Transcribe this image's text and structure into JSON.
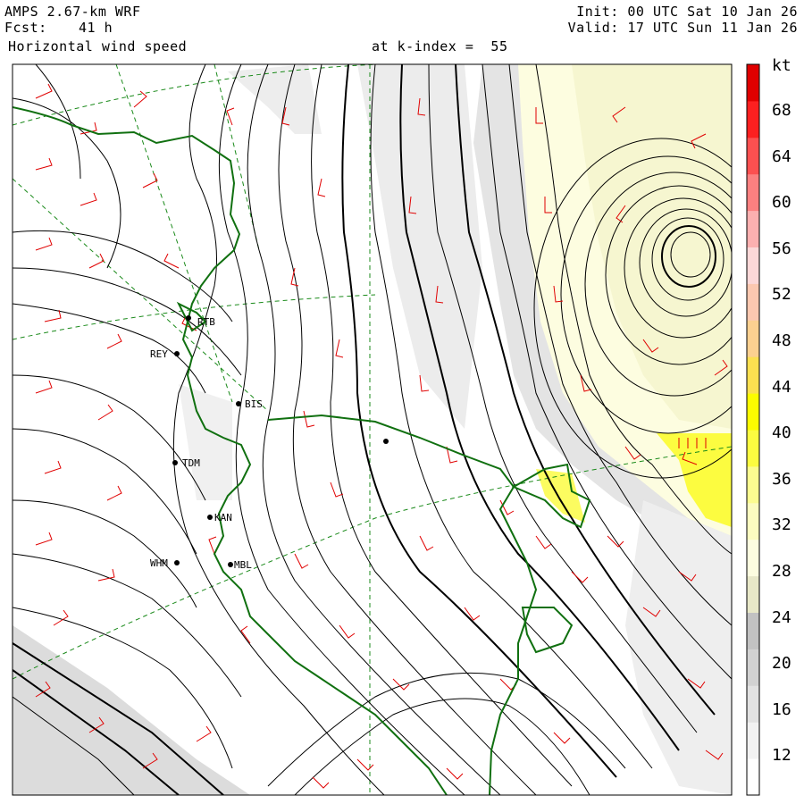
{
  "header": {
    "model": "AMPS 2.67-km WRF",
    "forecast_label": "Fcst:",
    "forecast_value": "41 h",
    "field": "Horizontal wind speed",
    "level": "at k-index =  55",
    "init": "Init: 00 UTC Sat 10 Jan 26",
    "valid": "Valid: 17 UTC Sun 11 Jan 26"
  },
  "colorbar": {
    "unit": "kt",
    "labels": [
      "68",
      "64",
      "60",
      "56",
      "52",
      "48",
      "44",
      "40",
      "36",
      "32",
      "28",
      "24",
      "20",
      "16",
      "12"
    ],
    "colors": [
      "#ffffff",
      "#f2f2f2",
      "#e2e2e2",
      "#d2d2d2",
      "#c2c2c2",
      "#e8e8c8",
      "#fdfde0",
      "#fcfcc0",
      "#fcfc90",
      "#fcfc40",
      "#fcfc00",
      "#fce050",
      "#fcd090",
      "#fcc8b0",
      "#fcd8d8",
      "#fcb0b0",
      "#fc8080",
      "#fc5050",
      "#fc2020",
      "#e00000"
    ]
  },
  "stations": [
    {
      "id": "RTB"
    },
    {
      "id": "REY"
    },
    {
      "id": "BIS"
    },
    {
      "id": "TDM"
    },
    {
      "id": "KAN"
    },
    {
      "id": "WHM"
    },
    {
      "id": "MBL"
    },
    {
      "id": ""
    }
  ],
  "colors": {
    "coast": "#107010",
    "barb": "#e00000",
    "grid": "#1a8a1a",
    "streamline": "#000000"
  }
}
